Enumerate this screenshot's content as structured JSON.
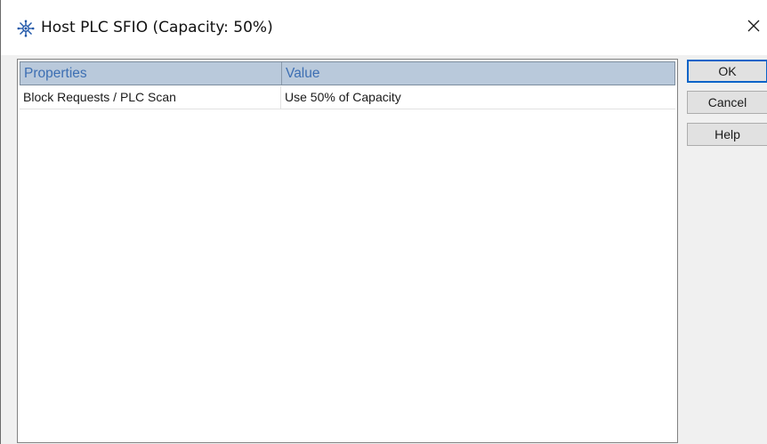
{
  "window": {
    "title": "Host PLC SFIO (Capacity: 50%)",
    "icon": "plc-network-icon",
    "close_icon": "close-icon"
  },
  "grid": {
    "columns": [
      "Properties",
      "Value"
    ],
    "rows": [
      {
        "property": "Block Requests / PLC Scan",
        "value": "Use 50% of Capacity"
      }
    ]
  },
  "buttons": {
    "ok": "OK",
    "cancel": "Cancel",
    "help": "Help"
  },
  "colors": {
    "header_bg": "#b9c9db",
    "header_text": "#3d6fb3",
    "default_button_border": "#0a64c8"
  }
}
